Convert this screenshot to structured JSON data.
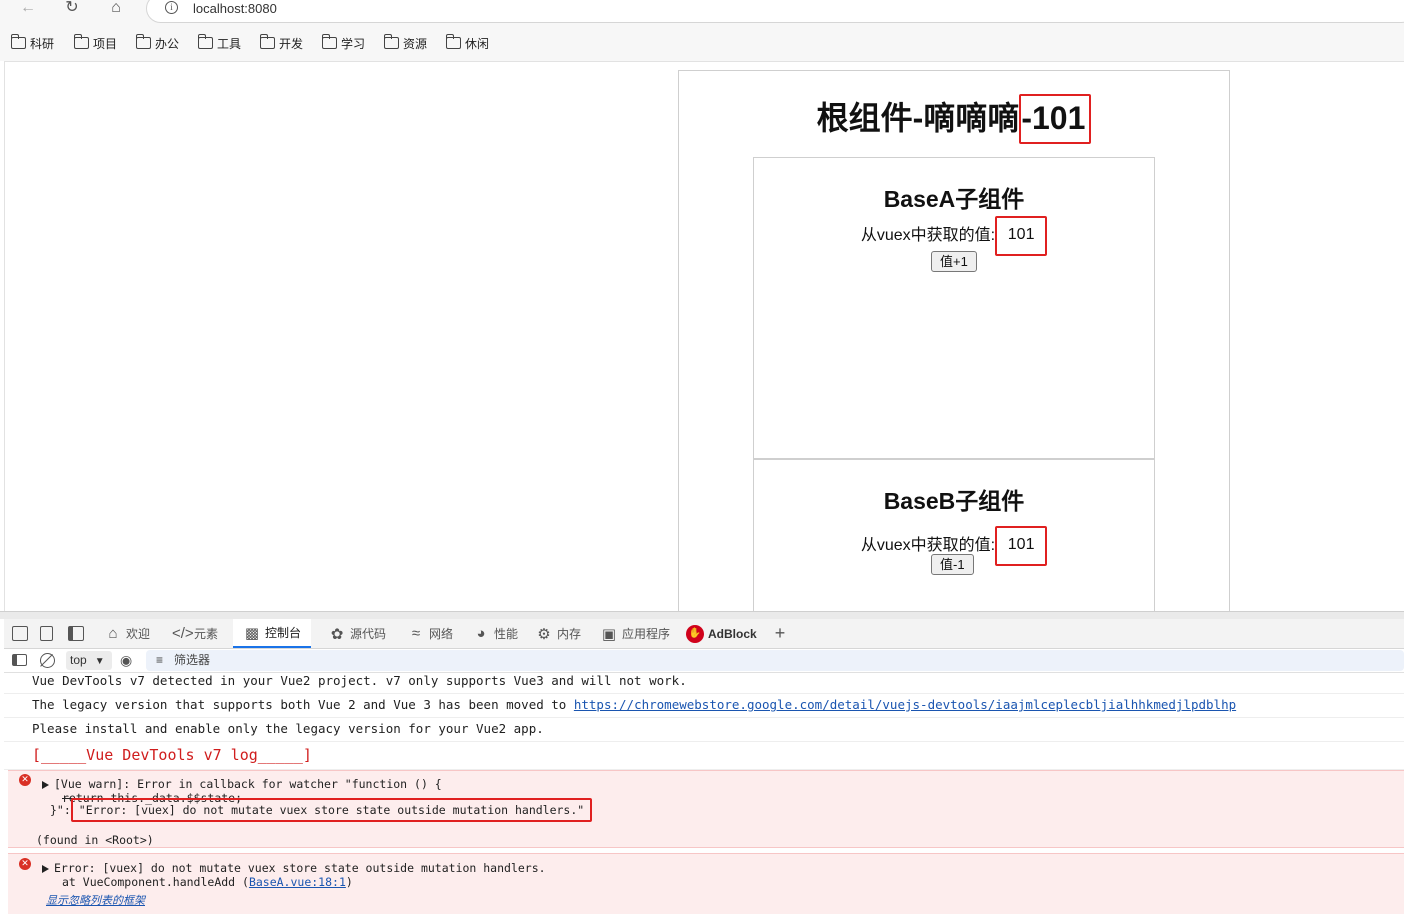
{
  "browser": {
    "url": "localhost:8080",
    "bookmarks": [
      "科研",
      "项目",
      "办公",
      "工具",
      "开发",
      "学习",
      "资源",
      "休闲"
    ]
  },
  "app": {
    "root_title": "根组件-嘀嘀嘀",
    "root_count": "-101",
    "child_a": {
      "title": "BaseA子组件",
      "label": "从vuex中获取的值:",
      "value": "101",
      "button": "值+1"
    },
    "child_b": {
      "title": "BaseB子组件",
      "label": "从vuex中获取的值:",
      "value": "101",
      "button": "值-1"
    }
  },
  "devtools": {
    "tabs": {
      "welcome": "欢迎",
      "elements": "元素",
      "console": "控制台",
      "sources": "源代码",
      "network": "网络",
      "performance": "性能",
      "memory": "内存",
      "application": "应用程序",
      "adblock": "AdBlock"
    },
    "context": "top",
    "filter_label": "筛选器",
    "console": {
      "line1": "Vue DevTools v7 detected in your Vue2 project. v7 only supports Vue3 and will not work.",
      "line2_text": "The legacy version that supports both Vue 2 and Vue 3 has been moved to ",
      "line2_link": " https://chromewebstore.google.com/detail/vuejs-devtools/iaajmlceplecbljialhhkmedjlpdblhp",
      "line3": "Please install and enable only the legacy version for your Vue2 app.",
      "line4": "[_____Vue DevTools v7 log_____]",
      "err1_line1": "[Vue warn]: Error in callback for watcher \"function () {",
      "err1_line2": "return this._data.$$state;",
      "err1_prefix": "}\":",
      "err1_highlight": "\"Error: [vuex] do not mutate vuex store state outside mutation handlers.\"",
      "err1_found": "(found in <Root>)",
      "err2_line1": "Error: [vuex] do not mutate vuex store state outside mutation handlers.",
      "err2_at": "at VueComponent.handleAdd (",
      "err2_link": "BaseA.vue:18:1",
      "err2_close": ")",
      "err2_ignored": "显示忽略列表的框架"
    }
  }
}
